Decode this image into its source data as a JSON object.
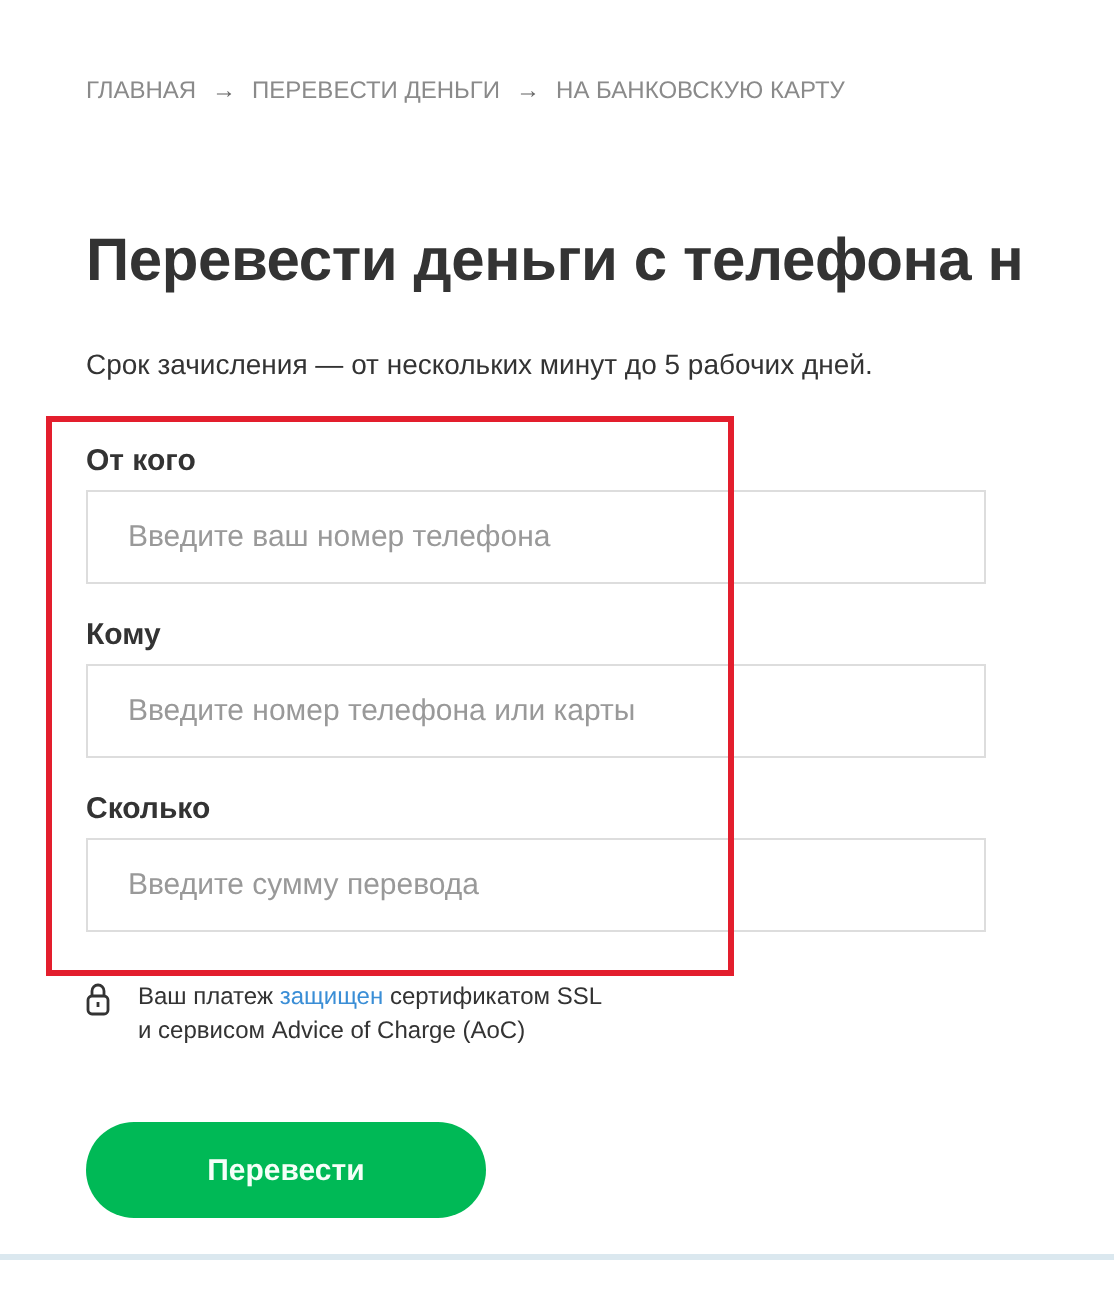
{
  "breadcrumbs": [
    {
      "label": "ГЛАВНАЯ"
    },
    {
      "label": "ПЕРЕВЕСТИ ДЕНЬГИ"
    },
    {
      "label": "НА БАНКОВСКУЮ КАРТУ"
    }
  ],
  "breadcrumb_separator": "→",
  "title": "Перевести деньги с телефона н",
  "subtitle": "Срок зачисления — от нескольких минут до 5 рабочих дней.",
  "fields": [
    {
      "label": "От кого",
      "placeholder": "Введите ваш номер телефона"
    },
    {
      "label": "Кому",
      "placeholder": "Введите номер телефона или карты"
    },
    {
      "label": "Сколько",
      "placeholder": "Введите сумму перевода"
    }
  ],
  "security_note": {
    "before": "Ваш платеж ",
    "link": "защищен",
    "after": " сертификатом SSL",
    "line2": "и сервисом Advice of Charge (AoC)"
  },
  "submit_button": "Перевести"
}
